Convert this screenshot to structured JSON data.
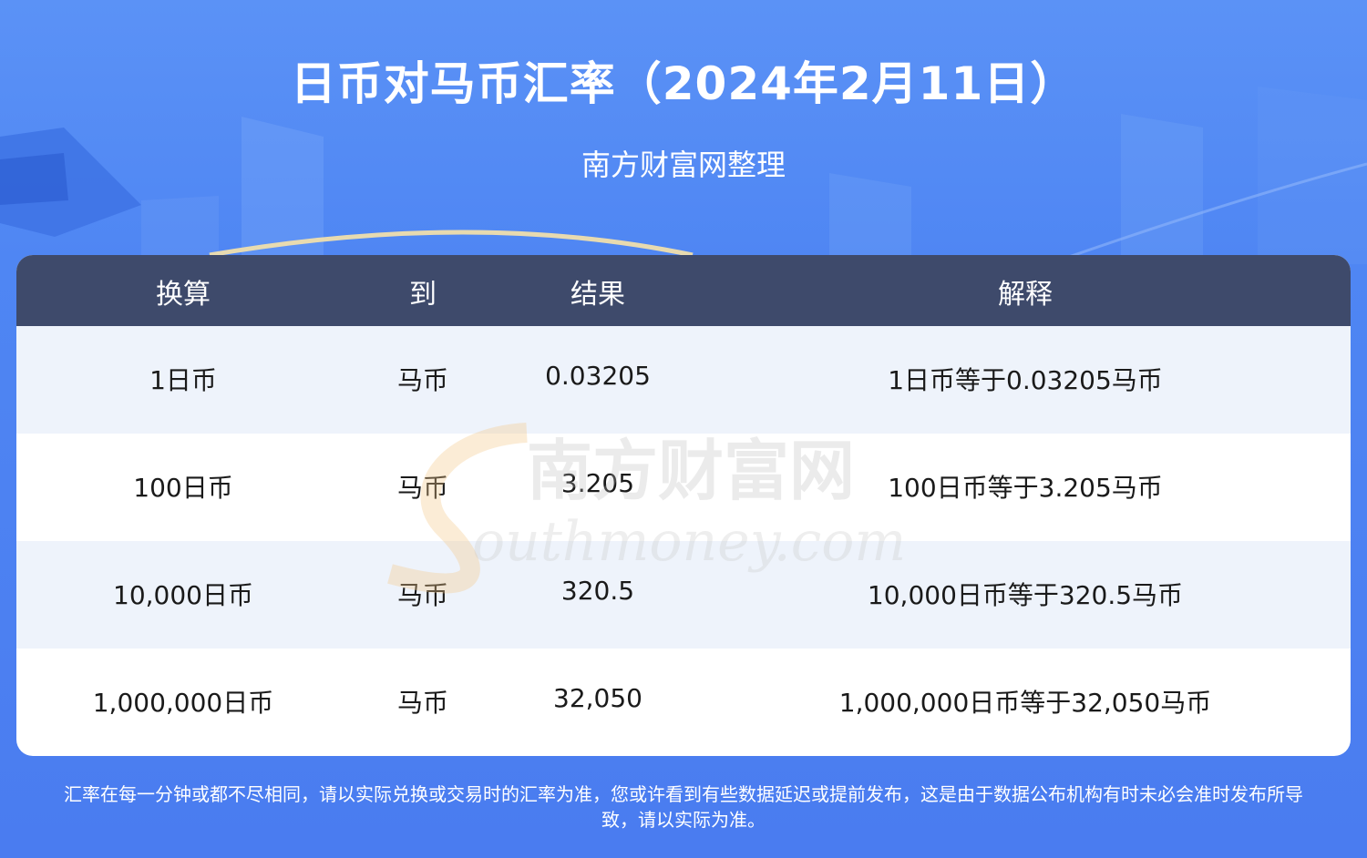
{
  "header": {
    "title": "日币对马币汇率（2024年2月11日）",
    "subtitle": "南方财富网整理"
  },
  "table": {
    "columns": [
      "换算",
      "到",
      "结果",
      "解释"
    ],
    "rows": [
      [
        "1日币",
        "马币",
        "0.03205",
        "1日币等于0.03205马币"
      ],
      [
        "100日币",
        "马币",
        "3.205",
        "100日币等于3.205马币"
      ],
      [
        "10,000日币",
        "马币",
        "320.5",
        "10,000日币等于320.5马币"
      ],
      [
        "1,000,000日币",
        "马币",
        "32,050",
        "1,000,000日币等于32,050马币"
      ]
    ]
  },
  "watermark": {
    "cn": "南方财富网",
    "en": "outhmoney.com"
  },
  "footer": {
    "line1": "汇率在每一分钟或都不尽相同，请以实际兑换或交易时的汇率为准，您或许看到有些数据延迟或提前发布，这是由于数据公布机构有时未必会准时发布所导",
    "line2": "致，请以实际为准。"
  },
  "colors": {
    "background": "#4a7cf0",
    "header_row": "#3e4a6b",
    "alt_row": "#eef3fb"
  }
}
